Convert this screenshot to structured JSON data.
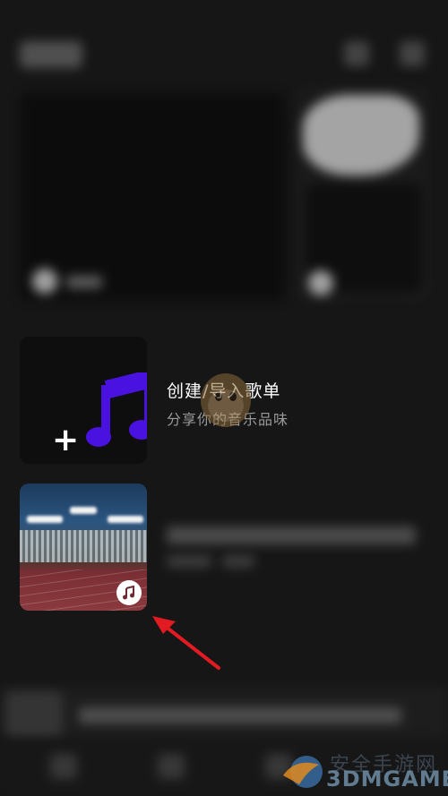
{
  "create_playlist": {
    "title": "创建/导入歌单",
    "subtitle": "分享你的音乐品味"
  },
  "watermark": {
    "brand": "3DMGAME",
    "cn_text": "安全手游网"
  },
  "colors": {
    "accent_note": "#4a12e0",
    "arrow": "#e21b23",
    "background": "#161616",
    "subtitle": "#9a9a9a"
  },
  "icons": {
    "create_thumb": "music-note-icon",
    "playlist_badge": "music-badge-icon"
  }
}
